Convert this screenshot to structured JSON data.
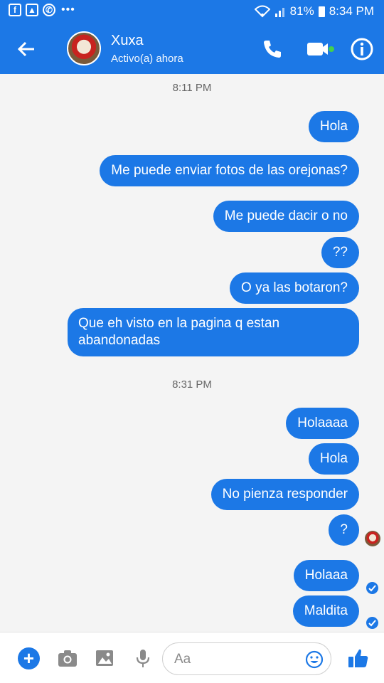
{
  "status_bar": {
    "battery": "81%",
    "time": "8:34 PM"
  },
  "header": {
    "contact_name": "Xuxa",
    "status": "Activo(a) ahora"
  },
  "timestamps": [
    "8:11 PM",
    "8:31 PM"
  ],
  "messages": [
    {
      "text": "Hola"
    },
    {
      "text": "Me puede enviar fotos de las orejonas?"
    },
    {
      "text": "Me puede dacir o no"
    },
    {
      "text": "??"
    },
    {
      "text": "O ya las botaron?"
    },
    {
      "text": "Que eh visto en la pagina q estan abandonadas"
    },
    {
      "text": "Holaaaa"
    },
    {
      "text": "Hola"
    },
    {
      "text": "No pienza responder"
    },
    {
      "text": "?"
    },
    {
      "text": "Holaaa"
    },
    {
      "text": "Maldita"
    }
  ],
  "composer": {
    "placeholder": "Aa"
  },
  "colors": {
    "accent": "#1c78e6",
    "online": "#44d04b"
  }
}
